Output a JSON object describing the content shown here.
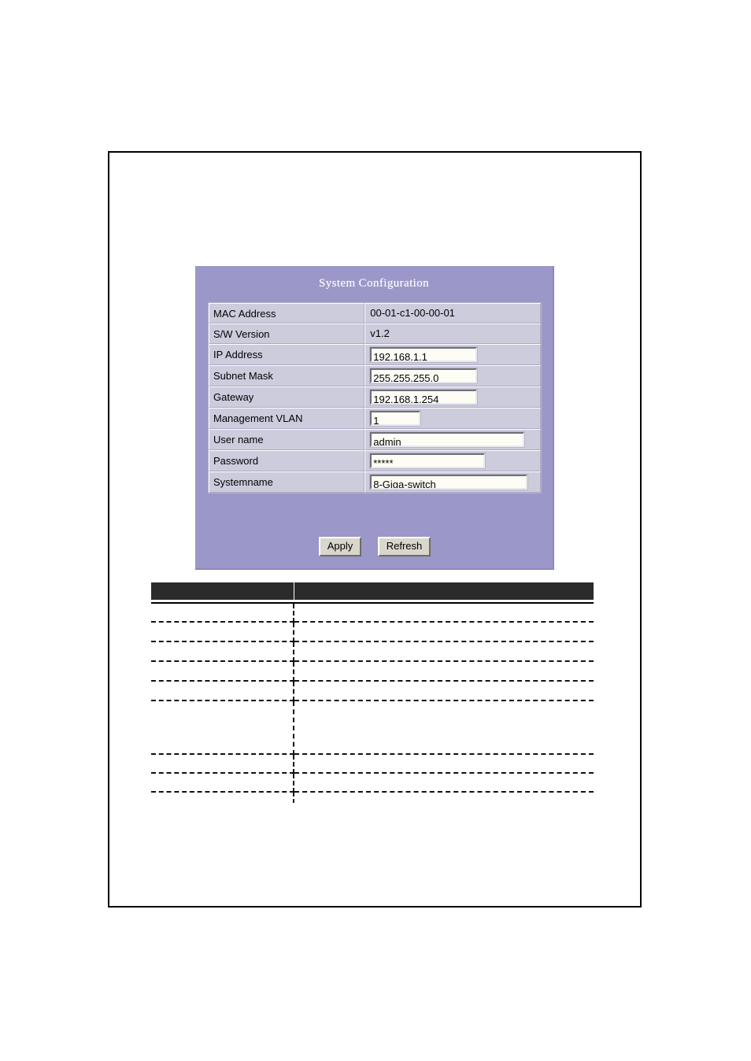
{
  "panel": {
    "title": "System Configuration",
    "accent_color": "#9b97c9",
    "cell_color": "#cdccdd",
    "field_color": "#fdfdf5"
  },
  "config": {
    "rows": [
      {
        "label": "MAC Address",
        "value": "00-01-c1-00-00-01",
        "type": "readonly"
      },
      {
        "label": "S/W Version",
        "value": "v1.2",
        "type": "readonly"
      },
      {
        "label": "IP Address",
        "value": "192.168.1.1",
        "type": "input"
      },
      {
        "label": "Subnet Mask",
        "value": "255.255.255.0",
        "type": "input"
      },
      {
        "label": "Gateway",
        "value": "192.168.1.254",
        "type": "input"
      },
      {
        "label": "Management VLAN",
        "value": "1",
        "type": "input"
      },
      {
        "label": "User name",
        "value": "admin",
        "type": "input"
      },
      {
        "label": "Password",
        "value": "*****",
        "type": "password"
      },
      {
        "label": "Systemname",
        "value": "8-Giga-switch",
        "type": "input"
      }
    ]
  },
  "buttons": {
    "apply": "Apply",
    "refresh": "Refresh"
  },
  "data_table": {
    "header_color": "#2b2b2b",
    "columns": [
      "",
      ""
    ],
    "rows": []
  }
}
